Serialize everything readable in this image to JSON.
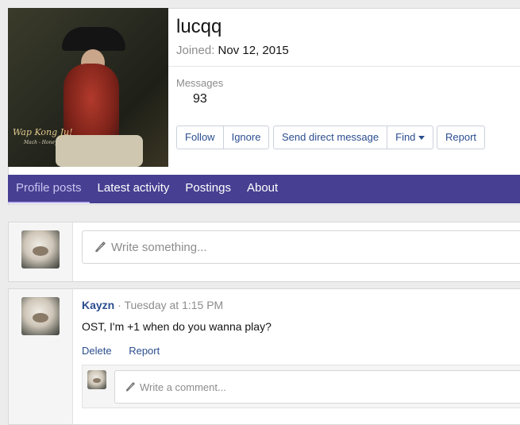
{
  "profile": {
    "username": "lucqq",
    "joined_label": "Joined:",
    "joined_date": "Nov 12, 2015",
    "messages_label": "Messages",
    "messages_count": "93",
    "banner_signature": "Wap Kong Ju!",
    "banner_subtext": "Mach - Honey"
  },
  "actions": {
    "follow": "Follow",
    "ignore": "Ignore",
    "send_dm": "Send direct message",
    "find": "Find",
    "report": "Report"
  },
  "tabs": [
    {
      "label": "Profile posts",
      "active": true
    },
    {
      "label": "Latest activity",
      "active": false
    },
    {
      "label": "Postings",
      "active": false
    },
    {
      "label": "About",
      "active": false
    }
  ],
  "composer": {
    "placeholder": "Write something..."
  },
  "post": {
    "author": "Kayzn",
    "separator": "·",
    "time": "Tuesday at 1:15 PM",
    "body": "OST, I'm +1 when do you wanna play?",
    "delete_label": "Delete",
    "report_label": "Report",
    "comment_placeholder": "Write a comment..."
  },
  "colors": {
    "tab_bar": "#473f91",
    "link": "#2b4d8f"
  }
}
